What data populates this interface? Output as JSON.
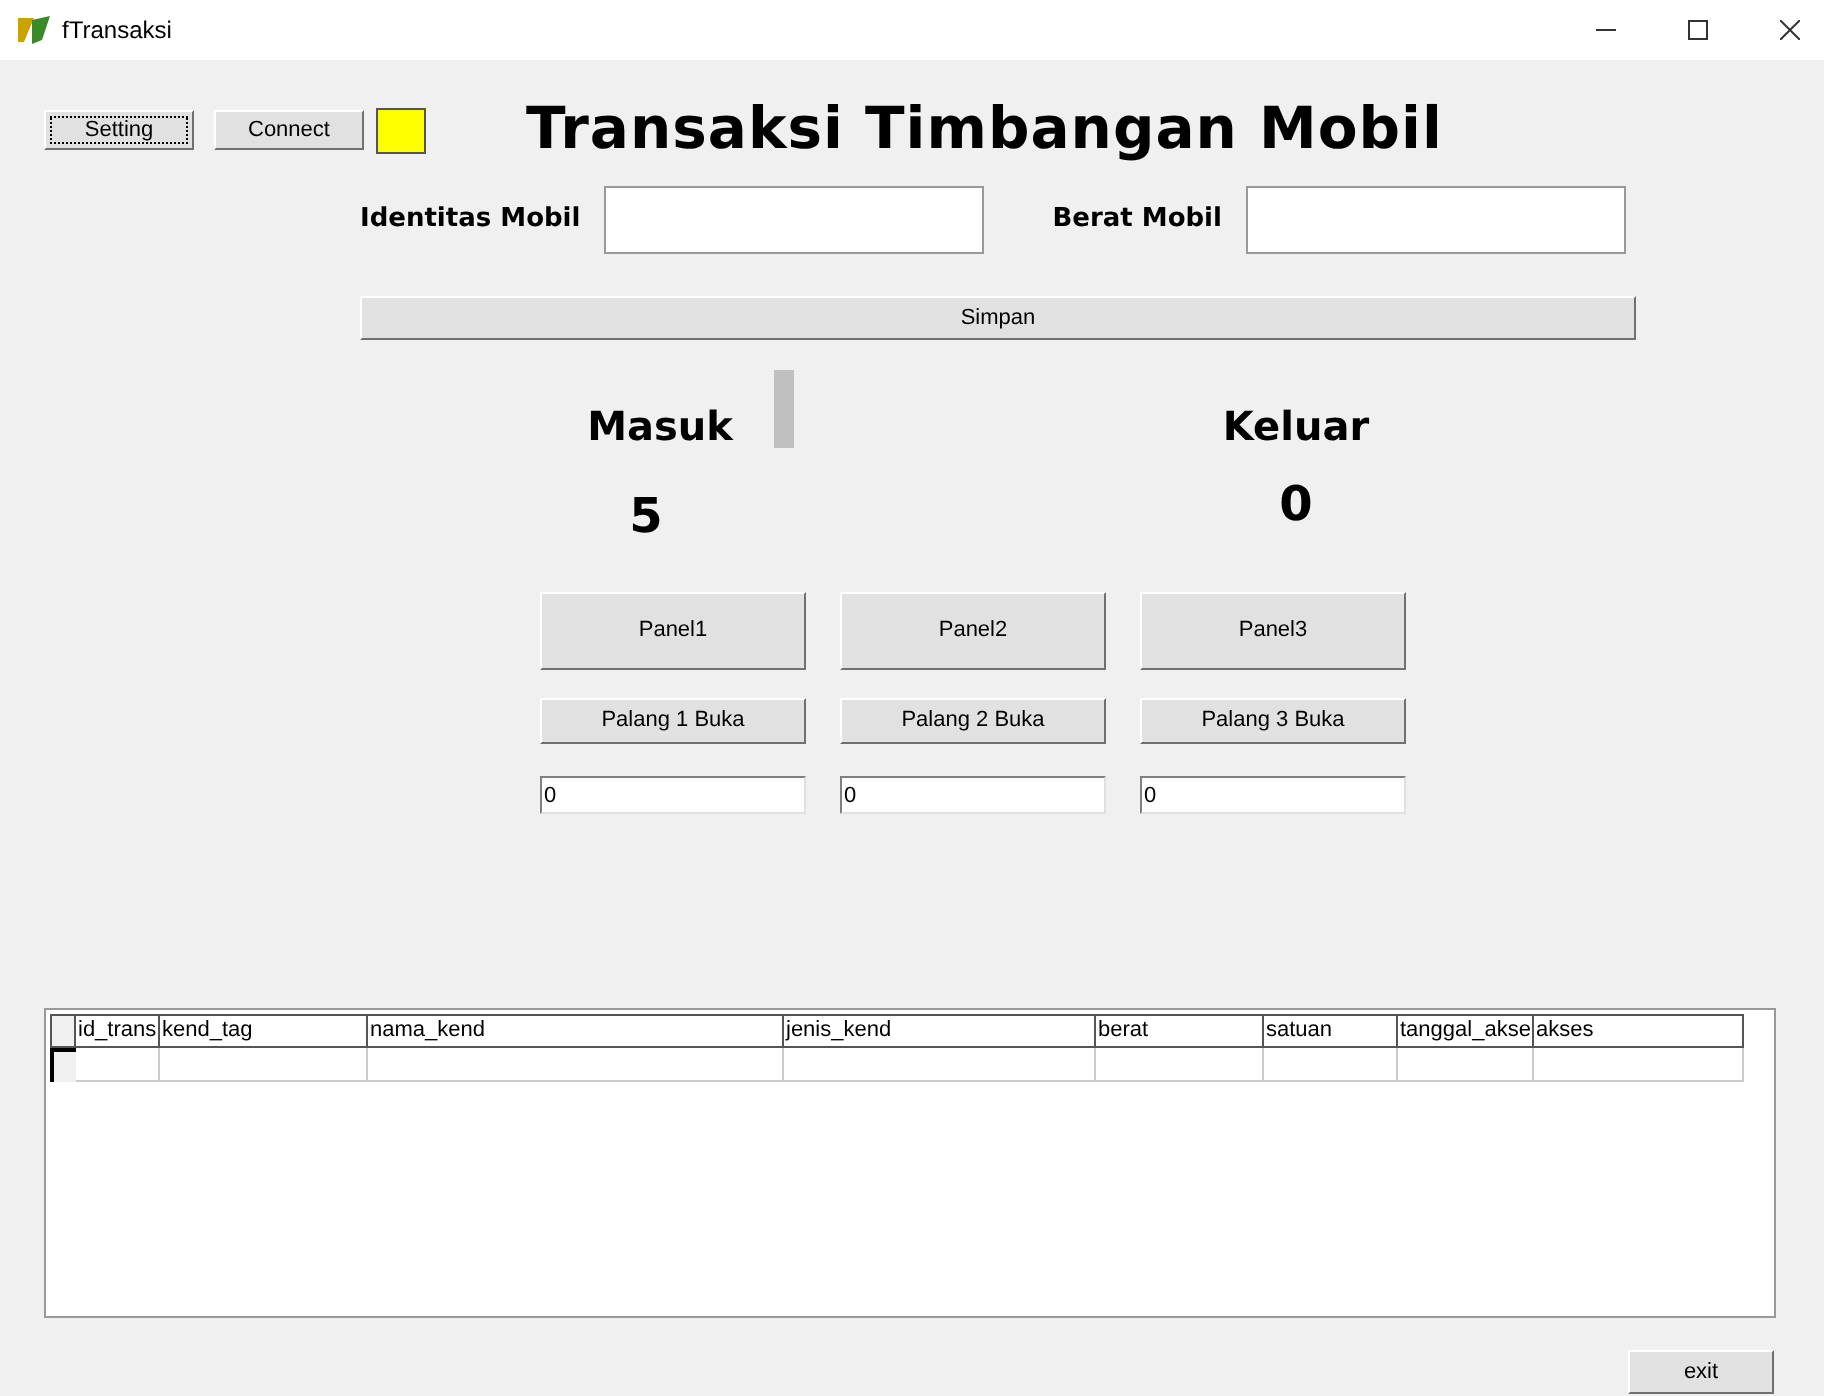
{
  "window": {
    "title": "fTransaksi"
  },
  "toolbar": {
    "buttons": [
      "Setting",
      "Connect"
    ]
  },
  "heading": "Transaksi Timbangan Mobil",
  "form": {
    "fields": [
      {
        "label": "Identitas Mobil"
      },
      {
        "label": "Berat Mobil"
      }
    ],
    "save_button": "Simpan"
  },
  "counters": [
    {
      "label": "Masuk",
      "value": "5"
    },
    {
      "label": "Keluar",
      "value": "0"
    }
  ],
  "panels": [
    {
      "panel_button": "Panel1",
      "gate_button": "Palang 1 Buka",
      "value": "0"
    },
    {
      "panel_button": "Panel2",
      "gate_button": "Palang 2 Buka",
      "value": "0"
    },
    {
      "panel_button": "Panel3",
      "gate_button": "Palang 3 Buka",
      "value": "0"
    }
  ],
  "table": {
    "columns": [
      "id_trans",
      "kend_tag",
      "nama_kend",
      "jenis_kend",
      "berat",
      "satuan",
      "tanggal_akse",
      "akses"
    ]
  },
  "exit_button": "exit"
}
